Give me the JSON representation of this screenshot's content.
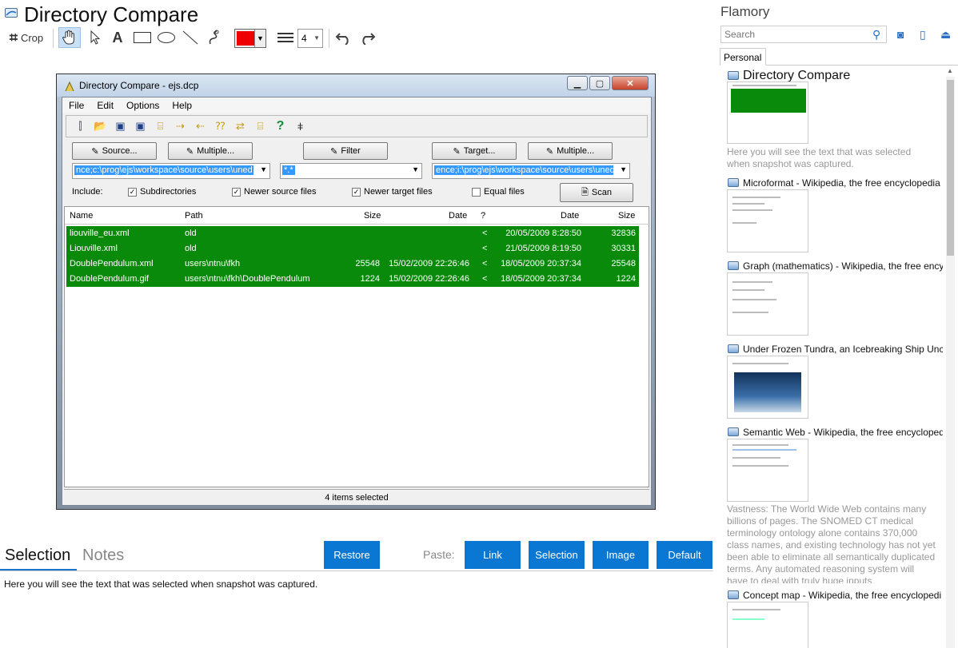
{
  "header": {
    "title": "Directory Compare",
    "crop_label": "Crop",
    "line_width_value": "4"
  },
  "screenshot": {
    "window_title": "Directory Compare - ejs.dcp",
    "menu": [
      "File",
      "Edit",
      "Options",
      "Help"
    ],
    "buttons": {
      "source": "Source...",
      "multiple_source": "Multiple...",
      "filter": "Filter",
      "target": "Target...",
      "multiple_target": "Multiple..."
    },
    "source_path": "nce;c:\\prog\\ejs\\workspace\\source\\users\\uned",
    "filter_value": "*.*",
    "target_path": "ence;i:\\prog\\ejs\\workspace\\source\\users\\uned",
    "include_label": "Include:",
    "checks": {
      "subdirectories": "Subdirectories",
      "newer_source": "Newer source files",
      "newer_target": "Newer target files",
      "equal": "Equal files"
    },
    "scan_label": "Scan",
    "columns": {
      "name": "Name",
      "path": "Path",
      "size": "Size",
      "date": "Date",
      "q": "?",
      "date2": "Date",
      "size2": "Size"
    },
    "rows": [
      {
        "name": "liouville_eu.xml",
        "path": "old",
        "size": "",
        "date": "",
        "dir": "<",
        "date2": "20/05/2009 8:28:50",
        "size2": "32836"
      },
      {
        "name": "Liouville.xml",
        "path": "old",
        "size": "",
        "date": "",
        "dir": "<",
        "date2": "21/05/2009 8:19:50",
        "size2": "30331"
      },
      {
        "name": "DoublePendulum.xml",
        "path": "users\\ntnu\\fkh",
        "size": "25548",
        "date": "15/02/2009 22:26:46",
        "dir": "<",
        "date2": "18/05/2009 20:37:34",
        "size2": "25548"
      },
      {
        "name": "DoublePendulum.gif",
        "path": "users\\ntnu\\fkh\\DoublePendulum",
        "size": "1224",
        "date": "15/02/2009 22:26:46",
        "dir": "<",
        "date2": "18/05/2009 20:37:34",
        "size2": "1224"
      }
    ],
    "status": "4 items selected"
  },
  "bottom": {
    "tab_selection": "Selection",
    "tab_notes": "Notes",
    "restore": "Restore",
    "paste_label": "Paste:",
    "link": "Link",
    "selection": "Selection",
    "image": "Image",
    "default": "Default",
    "selection_text": "Here you will see the text that was selected when snapshot was captured."
  },
  "right_panel": {
    "brand": "Flamory",
    "search_placeholder": "Search",
    "tab_personal": "Personal",
    "items": [
      {
        "title": "Directory Compare",
        "desc": "Here you will see the text that was selected when snapshot was captured."
      },
      {
        "title": "Microformat - Wikipedia, the free encyclopedia"
      },
      {
        "title": "Graph (mathematics) - Wikipedia, the free ency"
      },
      {
        "title": "Under Frozen Tundra, an Icebreaking Ship Unco"
      },
      {
        "title": "Semantic Web - Wikipedia, the free encycloped",
        "desc": "Vastness: The World Wide Web contains many billions of pages. The SNOMED CT medical terminology ontology alone contains 370,000 class names, and existing technology has not yet been able to eliminate all semantically duplicated terms. Any automated reasoning system will have to deal with truly huge inputs."
      },
      {
        "title": "Concept map - Wikipedia, the free encyclopedi"
      }
    ]
  },
  "colors": {
    "accent": "#0a78d2",
    "row_green": "#0a8a0a",
    "stroke_color": "#ee0000"
  }
}
